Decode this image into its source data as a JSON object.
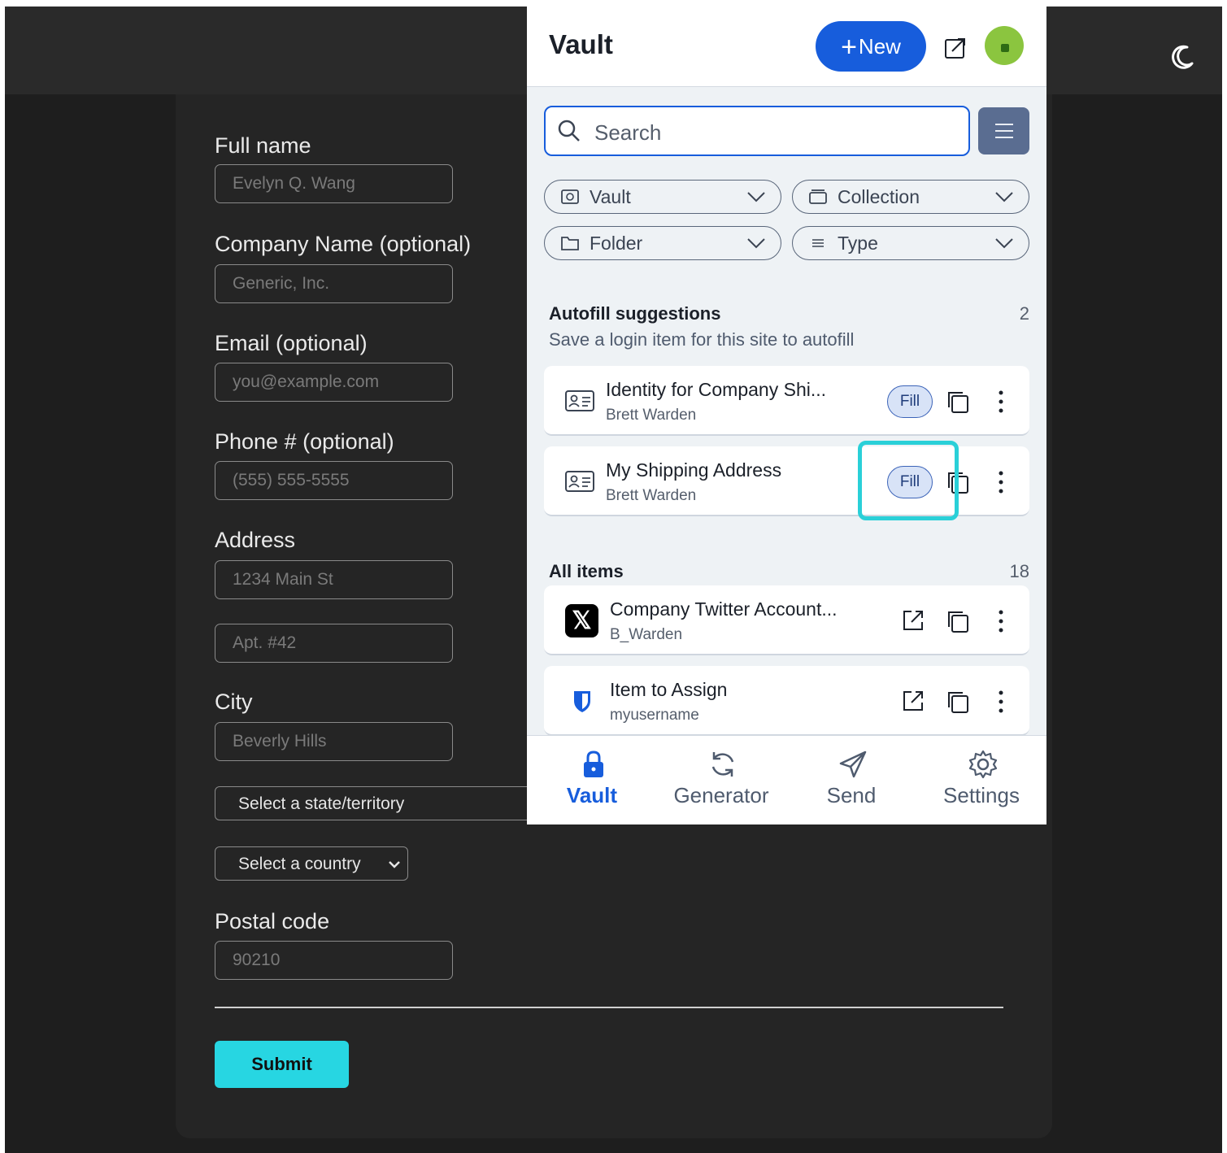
{
  "form": {
    "full_name_label": "Full name",
    "full_name_placeholder": "Evelyn Q. Wang",
    "company_label": "Company Name (optional)",
    "company_placeholder": "Generic, Inc.",
    "email_label": "Email (optional)",
    "email_placeholder": "you@example.com",
    "phone_label": "Phone # (optional)",
    "phone_placeholder": "(555) 555-5555",
    "address_label": "Address",
    "address1_placeholder": "1234 Main St",
    "address2_placeholder": "Apt. #42",
    "city_label": "City",
    "city_placeholder": "Beverly Hills",
    "state_select": "Select a state/territory",
    "country_select": "Select a country",
    "postal_label": "Postal code",
    "postal_placeholder": "90210",
    "submit_label": "Submit"
  },
  "popup": {
    "title": "Vault",
    "new_label": "New",
    "search_placeholder": "Search",
    "filters": [
      "Vault",
      "Collection",
      "Folder",
      "Type"
    ],
    "autofill": {
      "heading": "Autofill suggestions",
      "count": "2",
      "subtitle": "Save a login item for this site to autofill",
      "items": [
        {
          "title": "Identity for Company Shi...",
          "subtitle": "Brett Warden",
          "action": "Fill",
          "icon": "id-card-icon"
        },
        {
          "title": "My Shipping Address",
          "subtitle": "Brett Warden",
          "action": "Fill",
          "icon": "id-card-icon"
        }
      ]
    },
    "all_items": {
      "heading": "All items",
      "count": "18",
      "items": [
        {
          "title": "Company Twitter Account...",
          "subtitle": "B_Warden",
          "icon": "x-logo-icon",
          "logo_text": "𝕏"
        },
        {
          "title": "Item to Assign",
          "subtitle": "myusername",
          "icon": "bitwarden-shield-icon"
        }
      ]
    },
    "nav": [
      {
        "label": "Vault",
        "icon": "lock-icon",
        "active": true
      },
      {
        "label": "Generator",
        "icon": "refresh-icon",
        "active": false
      },
      {
        "label": "Send",
        "icon": "paper-plane-icon",
        "active": false
      },
      {
        "label": "Settings",
        "icon": "gear-icon",
        "active": false
      }
    ]
  },
  "colors": {
    "accent": "#175ddc",
    "submit": "#27d6e2",
    "highlight": "#2ad0d8",
    "avatar": "#8bc53f"
  }
}
